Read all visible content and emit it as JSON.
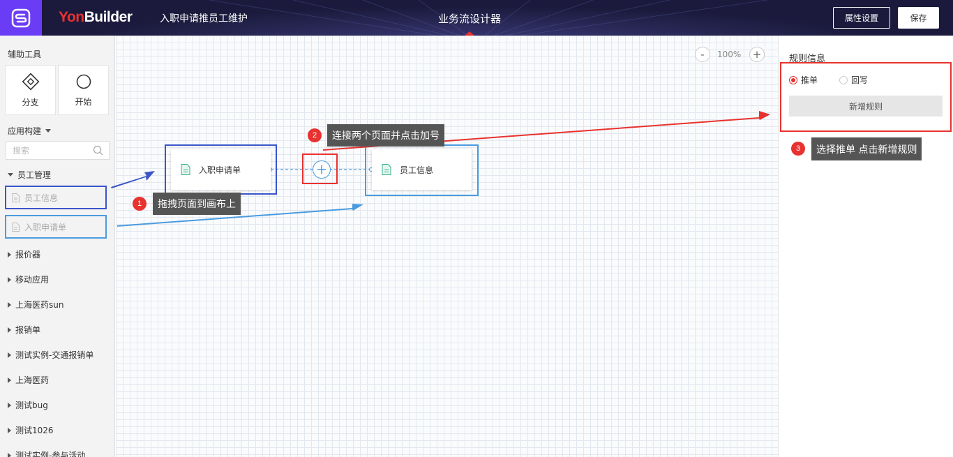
{
  "header": {
    "brand_yon": "Yon",
    "brand_builder": "Builder",
    "app_title": "入职申请推员工维护",
    "center_title": "业务流设计器",
    "props_button": "属性设置",
    "save_button": "保存"
  },
  "sidebar": {
    "tools_heading": "辅助工具",
    "tools": [
      {
        "label": "分支",
        "icon": "branch-diamond-icon"
      },
      {
        "label": "开始",
        "icon": "start-circle-icon"
      }
    ],
    "app_heading": "应用构建",
    "search_placeholder": "搜索",
    "expanded_group": "员工管理",
    "pages": [
      "员工信息",
      "入职申请单"
    ],
    "groups": [
      "报价器",
      "移动应用",
      "上海医药sun",
      "报销单",
      "测试实例-交通报销单",
      "上海医药",
      "测试bug",
      "测试1026",
      "测试实例-参与活动"
    ]
  },
  "canvas": {
    "zoom": "100%",
    "zoom_out": "-",
    "zoom_in": "+",
    "nodes": [
      "入职申请单",
      "员工信息"
    ]
  },
  "annotations": [
    {
      "number": "1",
      "text": "拖拽页面到画布上"
    },
    {
      "number": "2",
      "text": "连接两个页面并点击加号"
    },
    {
      "number": "3",
      "text": "选择推单 点击新增规则"
    }
  ],
  "right_panel": {
    "title": "规则信息",
    "radio_push": "推单",
    "radio_writeback": "回写",
    "add_rule_button": "新增规则",
    "selected": "推单"
  },
  "colors": {
    "header_bg": "#1b1a3c",
    "logo_bg": "#6b3cf5",
    "accent_red": "#e8322f",
    "frame_dark_blue": "#3a55c9",
    "frame_light_blue": "#4a9be0",
    "tooltip_bg": "#555555"
  }
}
